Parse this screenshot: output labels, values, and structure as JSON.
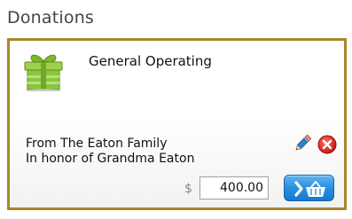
{
  "page": {
    "title": "Donations"
  },
  "donation": {
    "fund_name": "General Operating",
    "message_line1": "From The Eaton Family",
    "message_line2": "In honor of Grandma Eaton",
    "currency_symbol": "$",
    "amount": "400.00"
  },
  "icons": {
    "gift": "gift-icon",
    "edit": "pencil-icon",
    "remove": "remove-x-icon",
    "checkout": "chevron-basket-icon"
  },
  "colors": {
    "panel_border": "#a9862a",
    "gift_green": "#8cc63f",
    "remove_red": "#d9231f",
    "button_blue": "#2b8fe0"
  }
}
